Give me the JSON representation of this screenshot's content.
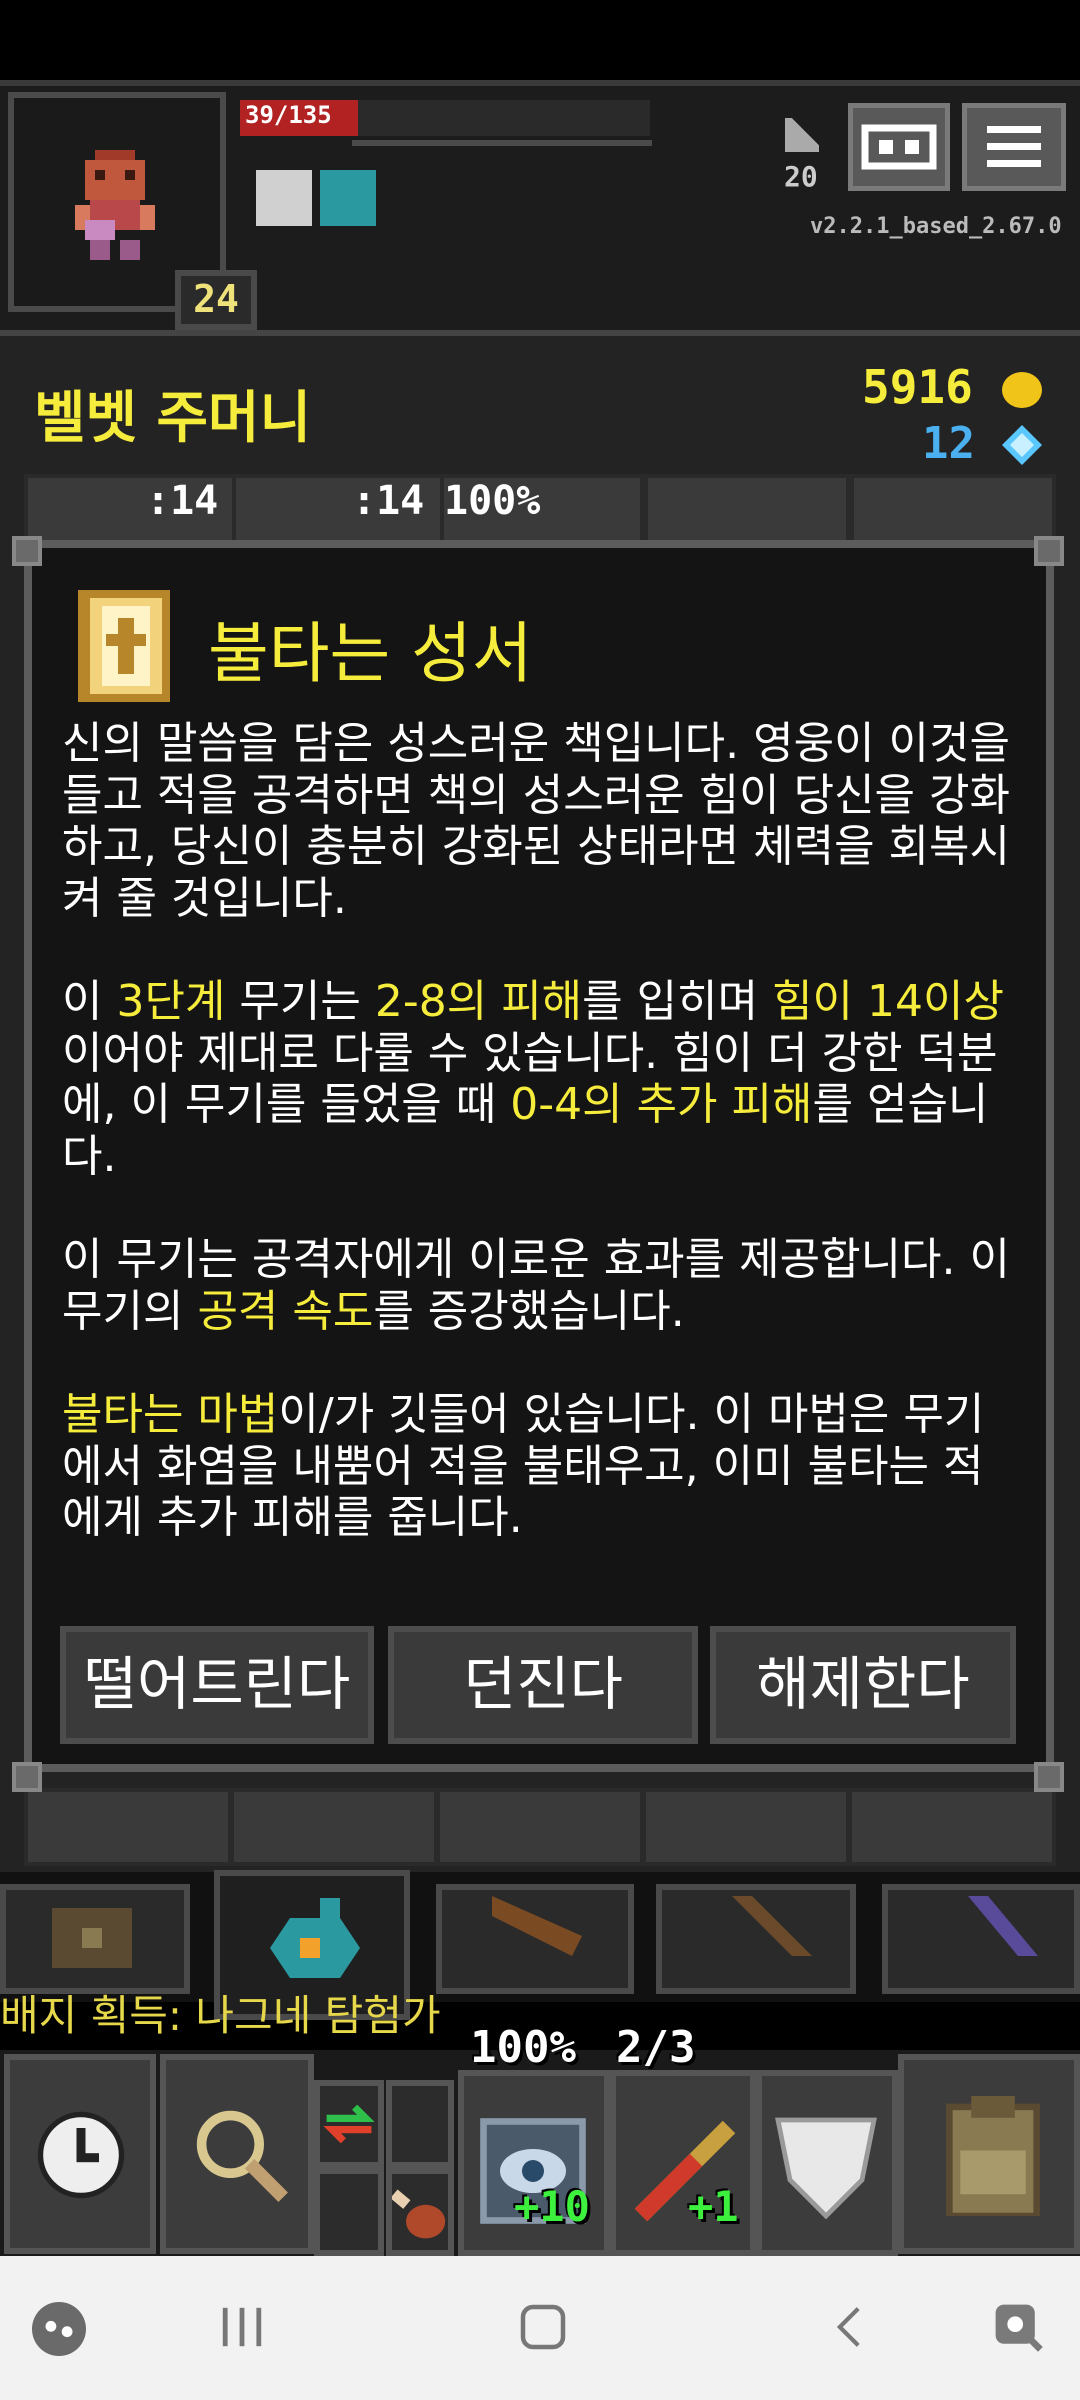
{
  "hud": {
    "hp_text": "39/135",
    "hp_fraction": 0.289,
    "level": "24",
    "depth": "20",
    "version": "v2.2.1_based_2.67.0"
  },
  "bag": {
    "title": "벨벳 주머니",
    "gold": "5916",
    "energy": "12",
    "slot_quantities": [
      ":14",
      ":14"
    ],
    "slot_percent": "100%"
  },
  "item_info": {
    "title": "불타는 성서",
    "para1": "신의 말씀을 담은 성스러운 책입니다. 영웅이 이것을 들고 적을 공격하면 책의 성스러운 힘이 당신을 강화하고, 당신이 충분히 강화된 상태라면 체력을 회복시켜 줄 것입니다.",
    "para2": {
      "t1": "이 ",
      "h1": "3단계",
      "t2": " 무기는 ",
      "h2": "2-8의 피해",
      "t3": "를 입히며 ",
      "h3": "힘이 14이상",
      "t4": "이어야 제대로 다룰 수 있습니다. 힘이 더 강한 덕분에, 이 무기를 들었을 때 ",
      "h4": "0-4의 추가 피해",
      "t5": "를 얻습니다."
    },
    "para3": {
      "t1": "이 무기는 공격자에게 이로운 효과를 제공합니다. 이 무기의 ",
      "h1": "공격 속도",
      "t2": "를 증강했습니다."
    },
    "para4": {
      "h1": "불타는 마법",
      "t1": "이/가 깃들어 있습니다. 이 마법은 무기에서 화염을 내뿜어 적을 불태우고, 이미 불타는 적에게 추가 피해를 줍니다."
    },
    "buttons": {
      "drop": "떨어트린다",
      "throw": "던진다",
      "unequip": "해제한다"
    }
  },
  "log": {
    "message": "배지 획득: 나그네 탐험가"
  },
  "quickslots": {
    "qs1_top": "100%",
    "qs1_bottom": "+10",
    "qs2_top": "2/3",
    "qs2_bottom": "+1"
  },
  "icons": {
    "journal": "journal-icon",
    "menu": "menu-icon",
    "gold": "gold-coin-icon",
    "energy": "energy-crystal-icon",
    "wait": "clock-icon",
    "search": "magnifier-icon",
    "swap": "swap-arrows-icon",
    "backpack": "backpack-icon"
  },
  "colors": {
    "highlight": "#f6ec3c",
    "energy": "#4ab0f0",
    "upgrade": "#3ef03e",
    "hp": "#b22222"
  }
}
